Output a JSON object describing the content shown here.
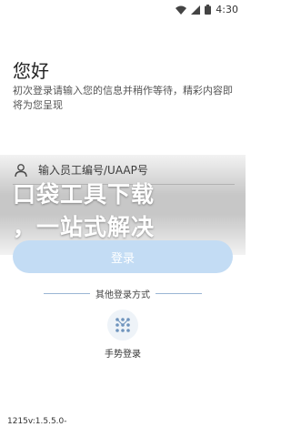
{
  "status_bar": {
    "time": "4:30",
    "icons": [
      "wifi-icon",
      "cellular-signal-icon",
      "battery-icon"
    ]
  },
  "greeting": "您好",
  "intro_text": "初次登录请输入您的信息并稍作等待，精彩内容即将为您呈现",
  "employee_input": {
    "icon": "user-icon",
    "placeholder": "输入员工编号/UAAP号"
  },
  "overlay": {
    "line1": "口袋工具下载",
    "line2": "，一站式解决"
  },
  "login_button_label": "登录",
  "other_methods_label": "其他登录方式",
  "gesture_login": {
    "icon": "gesture-grid-icon",
    "label": "手势登录"
  },
  "version": "1215v:1.5.5.0-",
  "colors": {
    "login_button": "#c3dcf4",
    "divider": "#9ab6d4",
    "gesture_icon_bg": "#eef3f8"
  }
}
